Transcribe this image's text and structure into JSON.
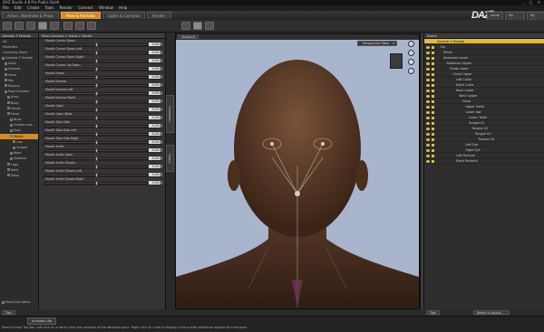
{
  "app": {
    "title": "DAZ Studio 4.8 Pro Public Build"
  },
  "menu": [
    "File",
    "Edit",
    "Create",
    "Tools",
    "Render",
    "Connect",
    "Window",
    "Help"
  ],
  "tabs": [
    {
      "label": "Actors, Wardrobe & Props",
      "active": false
    },
    {
      "label": "Pose & Animate",
      "active": true
    },
    {
      "label": "Lights & Cameras",
      "active": false
    },
    {
      "label": "Render",
      "active": false
    }
  ],
  "logo": {
    "text": "DAZ",
    "suffix": "3D"
  },
  "top_buttons": [
    "Home",
    "My Account",
    "My Gallery"
  ],
  "left_panel": {
    "selector": "Genesis 3 Female",
    "filters": [
      "All",
      "Favorites",
      "Currently Used"
    ],
    "tree": [
      {
        "label": "Genesis 3 Female",
        "indent": 0
      },
      {
        "label": "Actor",
        "indent": 1
      },
      {
        "label": "Genesis",
        "indent": 1
      },
      {
        "label": "Head",
        "indent": 1
      },
      {
        "label": "Hip",
        "indent": 1
      },
      {
        "label": "Morphs",
        "indent": 1
      },
      {
        "label": "Pose Controls",
        "indent": 1
      },
      {
        "label": "Arms",
        "indent": 2
      },
      {
        "label": "Body",
        "indent": 2
      },
      {
        "label": "Hands",
        "indent": 2
      },
      {
        "label": "Head",
        "indent": 2
      },
      {
        "label": "Brow",
        "indent": 3
      },
      {
        "label": "Cheeks and...",
        "indent": 3
      },
      {
        "label": "Eyes",
        "indent": 3
      },
      {
        "label": "Mouth",
        "indent": 3,
        "selected": true
      },
      {
        "label": "Lips",
        "indent": 4
      },
      {
        "label": "Tongue",
        "indent": 4
      },
      {
        "label": "Nose",
        "indent": 3
      },
      {
        "label": "Visemes",
        "indent": 3
      },
      {
        "label": "Legs",
        "indent": 2
      },
      {
        "label": "Neck",
        "indent": 2
      },
      {
        "label": "Torso",
        "indent": 2
      }
    ],
    "show_sub_items": "Show Sub Items"
  },
  "slider_panel": {
    "header": "Pose Controls > Head > Mouth",
    "sliders": [
      {
        "label": "Mouth Corner Down",
        "value": "0.0%",
        "pos": 0.5
      },
      {
        "label": "Mouth Corner Down Left",
        "value": "0.0%",
        "pos": 0.5
      },
      {
        "label": "Mouth Corner Down Right",
        "value": "0.0%",
        "pos": 0.5
      },
      {
        "label": "Mouth Corner Up-Down",
        "value": "0.0%",
        "pos": 0.5
      },
      {
        "label": "Mouth Frown",
        "value": "0.0%",
        "pos": 0.5
      },
      {
        "label": "Mouth Narrow",
        "value": "0.0%",
        "pos": 0.5
      },
      {
        "label": "Mouth Narrow Left",
        "value": "0.0%",
        "pos": 0.5
      },
      {
        "label": "Mouth Narrow Right",
        "value": "0.0%",
        "pos": 0.5
      },
      {
        "label": "Mouth Open",
        "value": "0.0%",
        "pos": 0.5
      },
      {
        "label": "Mouth Open Wide",
        "value": "0.0%",
        "pos": 0.5
      },
      {
        "label": "Mouth Side-Side",
        "value": "0.0%",
        "pos": 0.5
      },
      {
        "label": "Mouth Side-Side Left",
        "value": "0.0%",
        "pos": 0.5
      },
      {
        "label": "Mouth Side-Side Right",
        "value": "0.0%",
        "pos": 0.5
      },
      {
        "label": "Mouth Smile",
        "value": "0.0%",
        "pos": 0.5
      },
      {
        "label": "Mouth Smile Open",
        "value": "0.0%",
        "pos": 0.5
      },
      {
        "label": "Mouth Smile Simple",
        "value": "0.0%",
        "pos": 0.5
      },
      {
        "label": "Mouth Smile Simple Left",
        "value": "0.0%",
        "pos": 0.5
      },
      {
        "label": "Mouth Smile Simple Right",
        "value": "0.0%",
        "pos": 0.5
      }
    ]
  },
  "side_tabs": [
    "Parameters",
    "Posing"
  ],
  "viewport": {
    "tab": "Viewport",
    "camera": "Perspective View"
  },
  "scene": {
    "header": "Scene",
    "rows": [
      {
        "label": "Genesis 3 Female",
        "indent": 0,
        "selected": true
      },
      {
        "label": "Hip",
        "indent": 1
      },
      {
        "label": "Pelvis",
        "indent": 2
      },
      {
        "label": "Abdomen Lower",
        "indent": 2
      },
      {
        "label": "Abdomen Upper",
        "indent": 3
      },
      {
        "label": "Chest Lower",
        "indent": 4
      },
      {
        "label": "Chest Upper",
        "indent": 5
      },
      {
        "label": "Left Collar",
        "indent": 6
      },
      {
        "label": "Right Collar",
        "indent": 6
      },
      {
        "label": "Neck Lower",
        "indent": 6
      },
      {
        "label": "Neck Upper",
        "indent": 7
      },
      {
        "label": "Head",
        "indent": 8
      },
      {
        "label": "Upper Teeth",
        "indent": 9
      },
      {
        "label": "Lower Jaw",
        "indent": 9
      },
      {
        "label": "Lower Teeth",
        "indent": 10
      },
      {
        "label": "Tongue 01",
        "indent": 10
      },
      {
        "label": "Tongue 02",
        "indent": 11
      },
      {
        "label": "Tongue 03",
        "indent": 12
      },
      {
        "label": "Tongue 04",
        "indent": 13
      },
      {
        "label": "Left Eye",
        "indent": 9
      },
      {
        "label": "Right Eye",
        "indent": 9
      },
      {
        "label": "Left Pectoral",
        "indent": 6
      },
      {
        "label": "Right Pectoral",
        "indent": 6
      }
    ],
    "footer_tab": "Tips",
    "footer_select": "Select a Layout..."
  },
  "bottom": {
    "tabs": [
      "Tips",
      "Animate Lite"
    ],
    "status": "Parent Group Tab-Tab. Left click on a tab to view the contents of the attached pane. Right click on a tab to display a menu with additional options for that pane."
  },
  "colors": {
    "accent": "#d58a24",
    "selection": "#e6b92e",
    "viewport_bg": "#a9b5cc",
    "skin": "#5a3a26"
  }
}
